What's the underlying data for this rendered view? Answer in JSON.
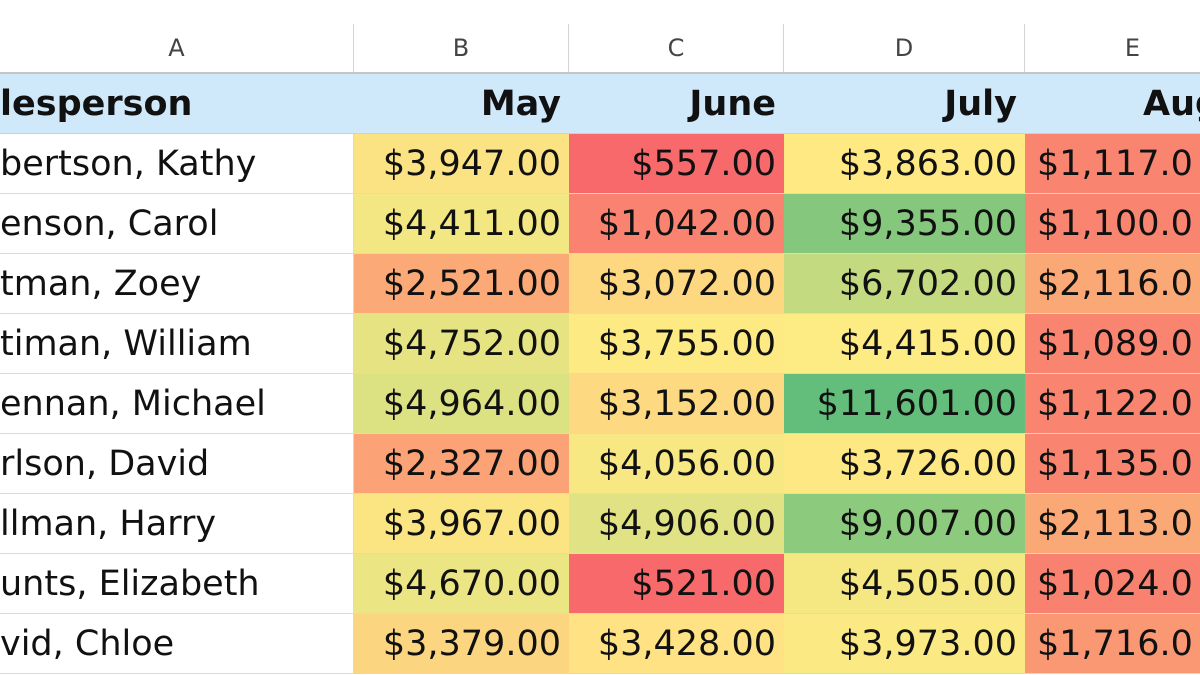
{
  "columns": [
    "A",
    "B",
    "C",
    "D",
    "E"
  ],
  "header": {
    "salesperson": "lesperson",
    "may": "May",
    "june": "June",
    "july": "July",
    "aug": "Aug"
  },
  "rows": [
    {
      "name": "bertson, Kathy",
      "may": "$3,947.00",
      "june": "$557.00",
      "july": "$3,863.00",
      "aug": "$1,117.0",
      "colors": {
        "may": "#fbe384",
        "june": "#f8696b",
        "july": "#fee983",
        "aug": "#f98570"
      }
    },
    {
      "name": "enson, Carol",
      "may": "$4,411.00",
      "june": "$1,042.00",
      "july": "$9,355.00",
      "aug": "$1,100.0",
      "colors": {
        "may": "#f2e783",
        "june": "#f98370",
        "july": "#85c87d",
        "aug": "#f98470"
      }
    },
    {
      "name": "tman, Zoey",
      "may": "$2,521.00",
      "june": "$3,072.00",
      "july": "$6,702.00",
      "aug": "$2,116.0",
      "colors": {
        "may": "#fbaa77",
        "june": "#fdd881",
        "july": "#c3da81",
        "aug": "#fba877"
      }
    },
    {
      "name": "timan, William",
      "may": "$4,752.00",
      "june": "$3,755.00",
      "july": "$4,415.00",
      "aug": "$1,089.0",
      "colors": {
        "may": "#e6e383",
        "june": "#feea83",
        "july": "#fdeb84",
        "aug": "#f98470"
      }
    },
    {
      "name": "ennan, Michael",
      "may": "$4,964.00",
      "june": "$3,152.00",
      "july": "$11,601.00",
      "aug": "$1,122.0",
      "colors": {
        "may": "#dce182",
        "june": "#fdda81",
        "july": "#63be7b",
        "aug": "#f98570"
      }
    },
    {
      "name": "rlson, David",
      "may": "$2,327.00",
      "june": "$4,056.00",
      "july": "$3,726.00",
      "aug": "$1,135.0",
      "colors": {
        "may": "#fba276",
        "june": "#f7e883",
        "july": "#fee883",
        "aug": "#f98570"
      }
    },
    {
      "name": "llman, Harry",
      "may": "$3,967.00",
      "june": "$4,906.00",
      "july": "$9,007.00",
      "aug": "$2,113.0",
      "colors": {
        "may": "#fbe583",
        "june": "#e0e283",
        "july": "#8ccb7e",
        "aug": "#fba877"
      }
    },
    {
      "name": "unts, Elizabeth",
      "may": "$4,670.00",
      "june": "$521.00",
      "july": "$4,505.00",
      "aug": "$1,024.0",
      "colors": {
        "may": "#ebe583",
        "june": "#f8696b",
        "july": "#f5e883",
        "aug": "#f9816f"
      }
    },
    {
      "name": "vid, Chloe",
      "may": "$3,379.00",
      "june": "$3,428.00",
      "july": "$3,973.00",
      "aug": "$1,716.0",
      "colors": {
        "may": "#fcd580",
        "june": "#fee283",
        "july": "#fbea84",
        "aug": "#fa9874"
      }
    }
  ]
}
